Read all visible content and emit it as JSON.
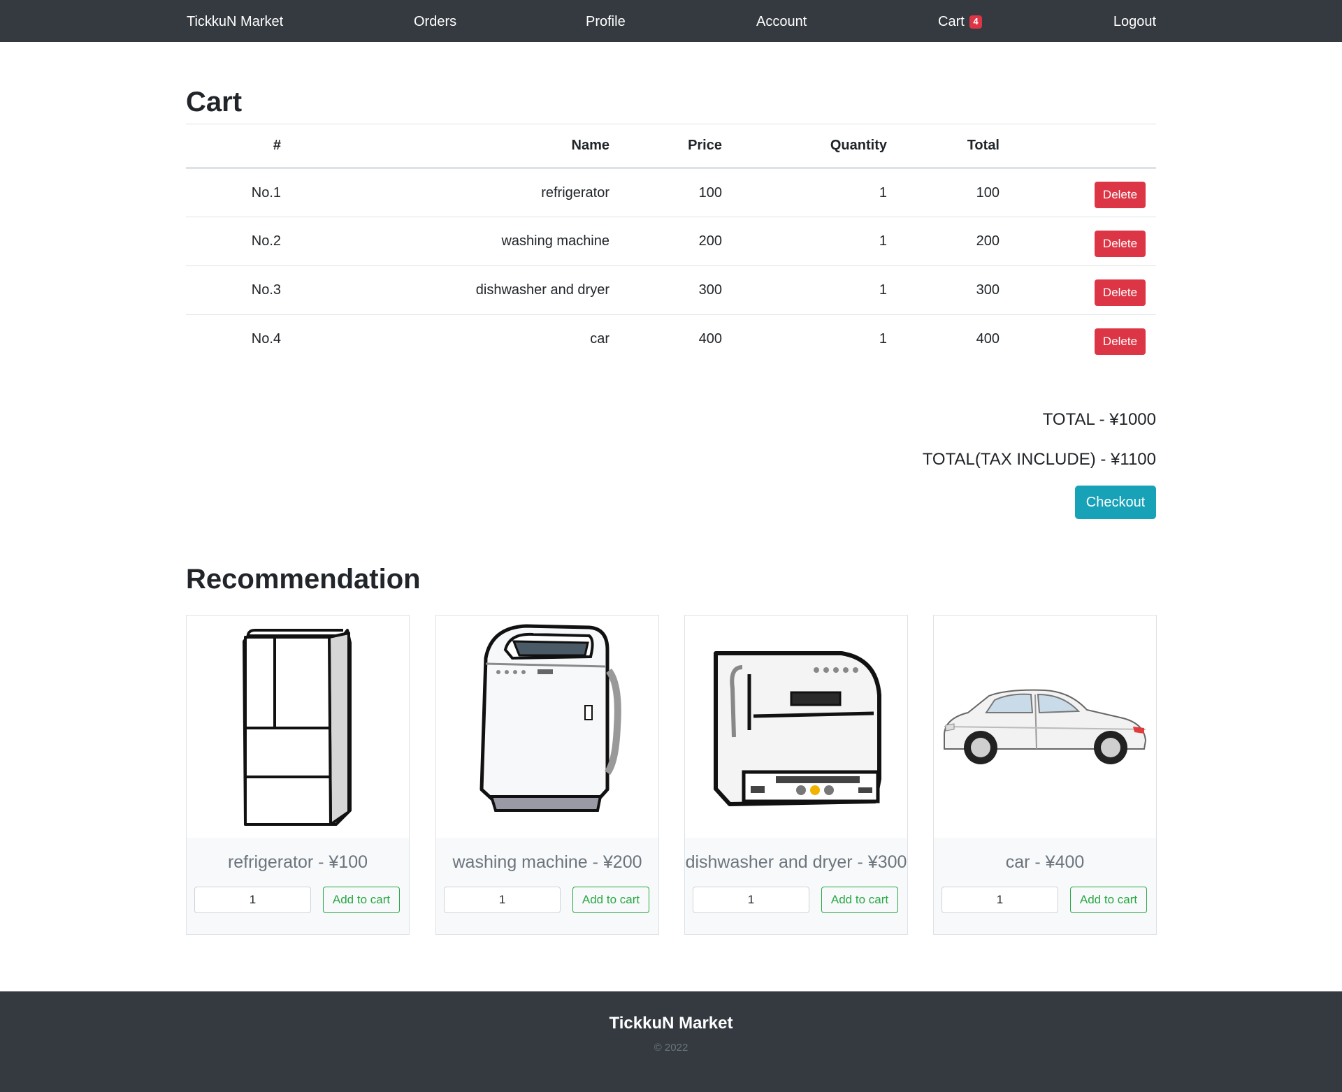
{
  "navbar": {
    "brand": "TickkuN Market",
    "orders": "Orders",
    "profile": "Profile",
    "account": "Account",
    "cart": "Cart",
    "cart_count": "4",
    "logout": "Logout"
  },
  "cart": {
    "title": "Cart",
    "headers": {
      "num": "#",
      "name": "Name",
      "price": "Price",
      "quantity": "Quantity",
      "total": "Total"
    },
    "rows": [
      {
        "num": "No.1",
        "name": "refrigerator",
        "price": "100",
        "quantity": "1",
        "total": "100",
        "action": "Delete"
      },
      {
        "num": "No.2",
        "name": "washing machine",
        "price": "200",
        "quantity": "1",
        "total": "200",
        "action": "Delete"
      },
      {
        "num": "No.3",
        "name": "dishwasher and dryer",
        "price": "300",
        "quantity": "1",
        "total": "300",
        "action": "Delete"
      },
      {
        "num": "No.4",
        "name": "car",
        "price": "400",
        "quantity": "1",
        "total": "400",
        "action": "Delete"
      }
    ],
    "total": "TOTAL - ¥1000",
    "total_tax": "TOTAL(TAX INCLUDE) - ¥1100",
    "checkout": "Checkout"
  },
  "recommendation": {
    "title": "Recommendation",
    "items": [
      {
        "caption": "refrigerator - ¥100",
        "quantity": "1",
        "button": "Add to cart",
        "icon": "refrigerator-image"
      },
      {
        "caption": "washing machine - ¥200",
        "quantity": "1",
        "button": "Add to cart",
        "icon": "washing-machine-image"
      },
      {
        "caption": "dishwasher and dryer - ¥300",
        "quantity": "1",
        "button": "Add to cart",
        "icon": "dishwasher-image"
      },
      {
        "caption": "car - ¥400",
        "quantity": "1",
        "button": "Add to cart",
        "icon": "car-image"
      }
    ]
  },
  "footer": {
    "brand": "TickkuN Market",
    "copyright": "© 2022"
  },
  "colors": {
    "navbar": "#343a40",
    "danger": "#dc3545",
    "info": "#17a2b8",
    "success": "#28a745",
    "muted": "#6c757d"
  }
}
